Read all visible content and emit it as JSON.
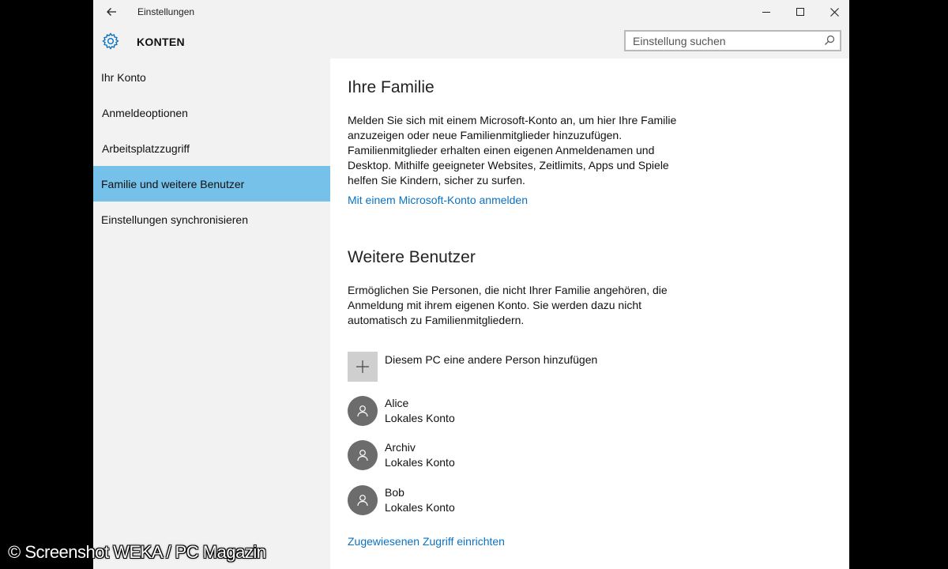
{
  "window": {
    "title": "Einstellungen",
    "header_title": "KONTEN"
  },
  "search": {
    "placeholder": "Einstellung suchen"
  },
  "icons": {
    "back": "back-arrow-icon",
    "minimize": "minimize-icon",
    "maximize": "maximize-icon",
    "close": "close-icon",
    "settings": "gear-icon",
    "search": "search-icon",
    "add": "plus-icon",
    "user": "person-icon"
  },
  "colors": {
    "accent": "#0b72c1",
    "nav_active": "#76c1ea",
    "chrome": "#f2f2f2",
    "avatar": "#6c6c6c"
  },
  "sidebar": {
    "items": [
      {
        "label": "Ihr Konto",
        "active": false
      },
      {
        "label": "Anmeldeoptionen",
        "active": false
      },
      {
        "label": "Arbeitsplatzzugriff",
        "active": false
      },
      {
        "label": "Familie und weitere Benutzer",
        "active": true
      },
      {
        "label": "Einstellungen synchronisieren",
        "active": false
      }
    ]
  },
  "main": {
    "family": {
      "heading": "Ihre Familie",
      "text": "Melden Sie sich mit einem Microsoft-Konto an, um hier Ihre Familie anzuzeigen oder neue Familienmitglieder hinzuzufügen. Familienmitglieder erhalten einen eigenen Anmeldenamen und Desktop. Mithilfe geeigneter Websites, Zeitlimits, Apps und Spiele helfen Sie Kindern, sicher zu surfen.",
      "link": "Mit einem Microsoft-Konto anmelden"
    },
    "others": {
      "heading": "Weitere Benutzer",
      "text": "Ermöglichen Sie Personen, die nicht Ihrer Familie angehören, die Anmeldung mit ihrem eigenen Konto. Sie werden dazu nicht automatisch zu Familienmitgliedern.",
      "add_label": "Diesem PC eine andere Person hinzufügen",
      "users": [
        {
          "name": "Alice",
          "type": "Lokales Konto"
        },
        {
          "name": "Archiv",
          "type": "Lokales Konto"
        },
        {
          "name": "Bob",
          "type": "Lokales Konto"
        }
      ],
      "assigned_link": "Zugewiesenen Zugriff einrichten"
    }
  },
  "watermark": "© Screenshot WEKA / PC Magazin"
}
